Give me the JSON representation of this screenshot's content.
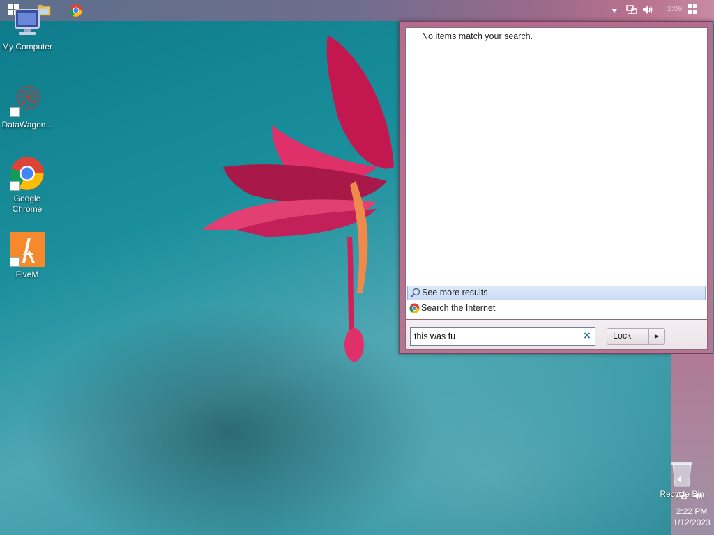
{
  "taskbar": {
    "clock": "2:09",
    "icons": [
      "windows-start-icon",
      "file-explorer-icon",
      "chrome-icon",
      "tray-overflow-icon",
      "network-icon",
      "volume-icon",
      "show-desktop-icon"
    ]
  },
  "desktop": {
    "icons": [
      {
        "label": "My Computer",
        "icon": "computer-icon"
      },
      {
        "label": "DataWagon...",
        "icon": "datawagon-icon"
      },
      {
        "label": "Google Chrome",
        "icon": "chrome-icon"
      },
      {
        "label": "FiveM",
        "icon": "fivem-icon"
      }
    ],
    "recycle_bin": "Recycle Bin"
  },
  "start_menu": {
    "no_results": "No items match your search.",
    "see_more": "See more results",
    "search_internet": "Search the Internet",
    "search_value": "this was fu",
    "clear_glyph": "×",
    "lock_label": "Lock"
  },
  "tray2": {
    "time": "2:22 PM",
    "date": "1/12/2023"
  },
  "colors": {
    "accent": "#b96f91",
    "highlight": "#c9dcf5"
  }
}
